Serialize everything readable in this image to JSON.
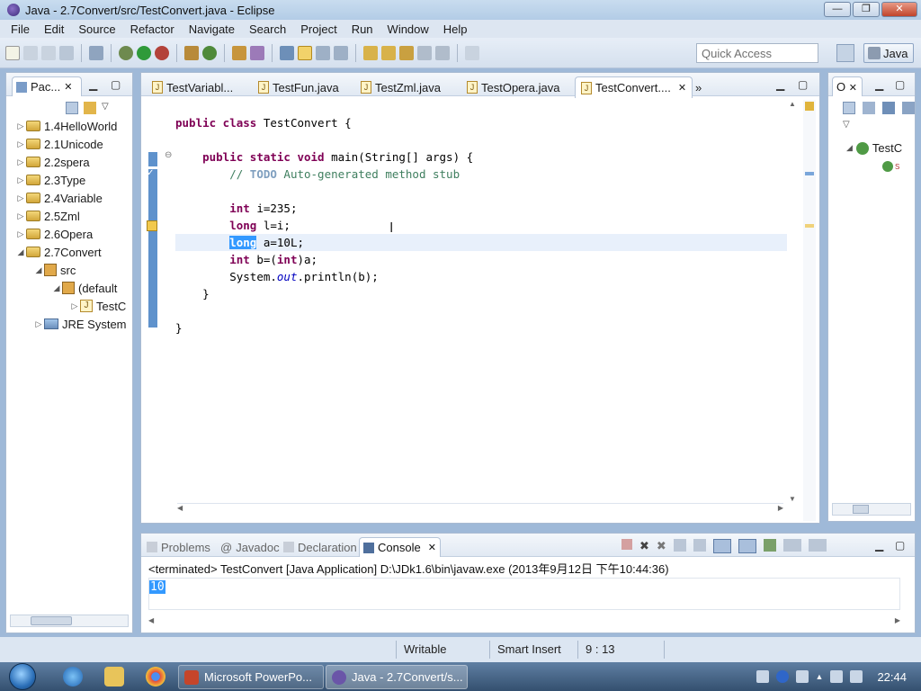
{
  "window": {
    "title": "Java - 2.7Convert/src/TestConvert.java - Eclipse",
    "min": "—",
    "max": "❐",
    "close": "✕"
  },
  "menu": [
    "File",
    "Edit",
    "Source",
    "Refactor",
    "Navigate",
    "Search",
    "Project",
    "Run",
    "Window",
    "Help"
  ],
  "toolbar": {
    "quick_access": "Quick Access",
    "perspective": "Java"
  },
  "package_explorer": {
    "tab": "Pac...",
    "tab_close": "✕",
    "items": [
      {
        "label": "1.4HelloWorld",
        "arrow": "▷"
      },
      {
        "label": "2.1Unicode",
        "arrow": "▷"
      },
      {
        "label": "2.2spera",
        "arrow": "▷"
      },
      {
        "label": "2.3Type",
        "arrow": "▷"
      },
      {
        "label": "2.4Variable",
        "arrow": "▷"
      },
      {
        "label": "2.5Zml",
        "arrow": "▷"
      },
      {
        "label": "2.6Opera",
        "arrow": "▷"
      },
      {
        "label": "2.7Convert",
        "arrow": "◢"
      },
      {
        "label": "src",
        "arrow": "◢"
      },
      {
        "label": "(default",
        "arrow": "◢"
      },
      {
        "label": "TestC",
        "arrow": "▷"
      },
      {
        "label": "JRE System",
        "arrow": "▷"
      }
    ]
  },
  "editor": {
    "tabs": [
      "TestVariabl...",
      "TestFun.java",
      "TestZml.java",
      "TestOpera.java",
      "TestConvert...."
    ],
    "tab_close": "✕",
    "more_tabs": "»",
    "code": {
      "l1_kw": "public class",
      "l1_rest": " TestConvert {",
      "l2_kw1": "public static void",
      "l2_rest": " main(String[] args) {",
      "l3_comment": "// ",
      "l3_todo": "TODO",
      "l3_rest": " Auto-generated method stub",
      "l4_kw": "int",
      "l4_rest": " i=235;",
      "l5_kw": "long",
      "l5_rest": " l=i;",
      "l6_kw": "long",
      "l6_rest": " a=10L;",
      "l7_kw1": "int",
      "l7_mid": " b=(",
      "l7_kw2": "int",
      "l7_rest": ")a;",
      "l8_pre": "System.",
      "l8_it": "out",
      "l8_rest": ".println(b);",
      "close1": "}",
      "close2": "}"
    }
  },
  "outline": {
    "tab": "O",
    "tab_close": "✕",
    "item": "TestC",
    "sub": "S"
  },
  "console": {
    "tabs": [
      "Problems",
      "Javadoc",
      "Declaration",
      "Console"
    ],
    "tab_close": "✕",
    "status": "<terminated> TestConvert [Java Application] D:\\JDk1.6\\bin\\javaw.exe (2013年9月12日 下午10:44:36)",
    "output": "10"
  },
  "statusbar": {
    "mode": "Writable",
    "insert": "Smart Insert",
    "position": "9 : 13"
  },
  "taskbar": {
    "buttons": [
      "Microsoft PowerPo...",
      "Java - 2.7Convert/s..."
    ],
    "clock": "22:44"
  }
}
